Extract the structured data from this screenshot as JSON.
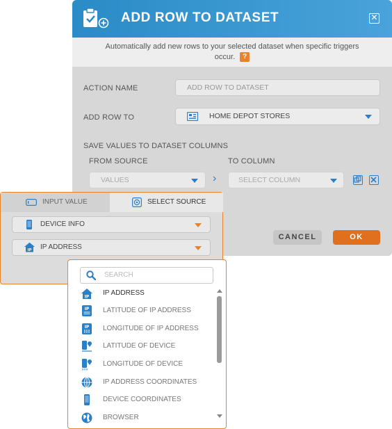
{
  "dialog": {
    "title": "ADD ROW TO DATASET",
    "description_line1": "Automatically add new rows to your selected dataset when specific triggers",
    "description_line2": "occur.",
    "help_badge": "?",
    "close_glyph": "✕",
    "action_name_label": "ACTION NAME",
    "action_name_placeholder": "ADD ROW TO DATASET",
    "add_row_to_label": "ADD ROW TO",
    "add_row_to_value": "HOME DEPOT STORES",
    "save_values_label": "SAVE VALUES TO DATASET COLUMNS",
    "from_source_label": "FROM SOURCE",
    "from_source_value": "VALUES",
    "to_column_label": "TO COLUMN",
    "to_column_placeholder": "SELECT COLUMN",
    "arrow_glyph": "›",
    "cancel_label": "CANCEL",
    "ok_label": "OK"
  },
  "source_popup": {
    "tabs": [
      {
        "label": "INPUT VALUE",
        "icon": "input-value-icon"
      },
      {
        "label": "SELECT SOURCE",
        "icon": "select-source-icon"
      }
    ],
    "source_type": "DEVICE INFO",
    "source_field": "IP ADDRESS"
  },
  "dropdown": {
    "search_placeholder": "SEARCH",
    "items": [
      {
        "label": "IP ADDRESS",
        "icon": "ip-house-icon"
      },
      {
        "label": "LATITUDE OF IP ADDRESS",
        "icon": "ip-latitude-icon"
      },
      {
        "label": "LONGITUDE OF IP ADDRESS",
        "icon": "ip-longitude-icon"
      },
      {
        "label": "LATITUDE OF DEVICE",
        "icon": "device-latitude-icon"
      },
      {
        "label": "LONGITUDE OF DEVICE",
        "icon": "device-longitude-icon"
      },
      {
        "label": "IP ADDRESS COORDINATES",
        "icon": "globe-grid-icon"
      },
      {
        "label": "DEVICE COORDINATES",
        "icon": "phone-icon"
      },
      {
        "label": "BROWSER",
        "icon": "globe-icon"
      }
    ]
  },
  "colors": {
    "accent_blue": "#2b7fc6",
    "accent_orange": "#e8822b",
    "ok_orange": "#e0701e"
  }
}
